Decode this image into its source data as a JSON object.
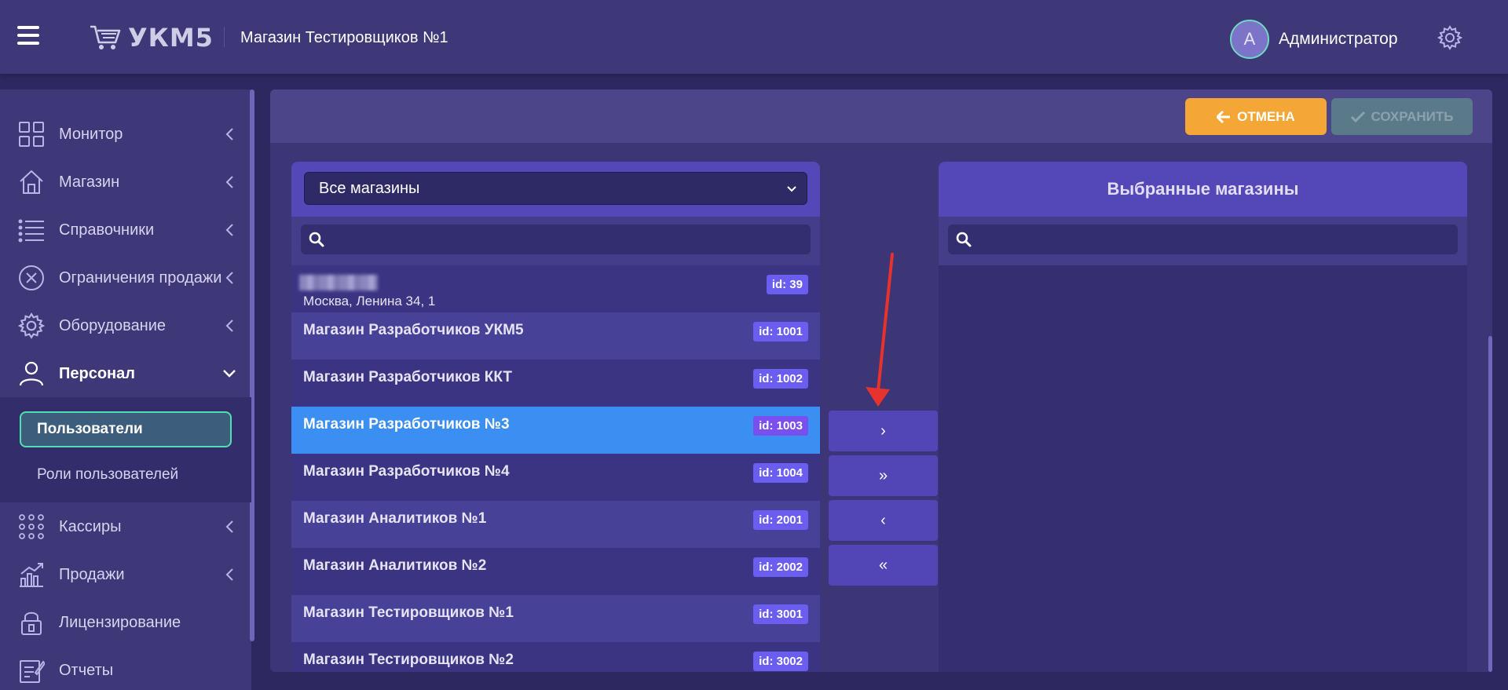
{
  "header": {
    "logo_text": "УКМ5",
    "store_title": "Магазин Тестировщиков №1",
    "user_initial": "A",
    "user_name": "Администратор"
  },
  "sidebar": {
    "items": [
      {
        "label": "Монитор",
        "icon": "grid-icon"
      },
      {
        "label": "Магазин",
        "icon": "home-icon"
      },
      {
        "label": "Справочники",
        "icon": "list-icon"
      },
      {
        "label": "Ограничения продажи",
        "icon": "circle-x-icon"
      },
      {
        "label": "Оборудование",
        "icon": "gear-icon"
      },
      {
        "label": "Персонал",
        "icon": "user-icon"
      },
      {
        "label": "Кассиры",
        "icon": "dots-grid-icon"
      },
      {
        "label": "Продажи",
        "icon": "chart-icon"
      },
      {
        "label": "Лицензирование",
        "icon": "lock-icon"
      },
      {
        "label": "Отчеты",
        "icon": "report-icon"
      }
    ],
    "submenu": [
      {
        "label": "Пользователи"
      },
      {
        "label": "Роли пользователей"
      }
    ]
  },
  "toolbar": {
    "cancel_label": "ОТМЕНА",
    "save_label": "СОХРАНИТЬ"
  },
  "left_panel": {
    "select_value": "Все магазины",
    "search_placeholder": "",
    "rows": [
      {
        "name": "",
        "address": "Москва, Ленина 34, 1",
        "badge": "id: 39"
      },
      {
        "name": "Магазин Разработчиков УКМ5",
        "badge": "id: 1001"
      },
      {
        "name": "Магазин Разработчиков ККТ",
        "badge": "id: 1002"
      },
      {
        "name": "Магазин Разработчиков №3",
        "badge": "id: 1003"
      },
      {
        "name": "Магазин Разработчиков №4",
        "badge": "id: 1004"
      },
      {
        "name": "Магазин Аналитиков №1",
        "badge": "id: 2001"
      },
      {
        "name": "Магазин Аналитиков №2",
        "badge": "id: 2002"
      },
      {
        "name": "Магазин Тестировщиков №1",
        "badge": "id: 3001"
      },
      {
        "name": "Магазин Тестировщиков №2",
        "badge": "id: 3002"
      }
    ]
  },
  "move_buttons": {
    "move_one": "›",
    "move_all": "»",
    "remove_one": "‹",
    "remove_all": "«"
  },
  "right_panel": {
    "title": "Выбранные магазины",
    "search_placeholder": ""
  },
  "colors": {
    "accent": "#5448b8",
    "selected_row": "#3b8ef2",
    "cancel": "#f4a737",
    "badge": "#6a5df0",
    "annotation": "#e8322e"
  }
}
